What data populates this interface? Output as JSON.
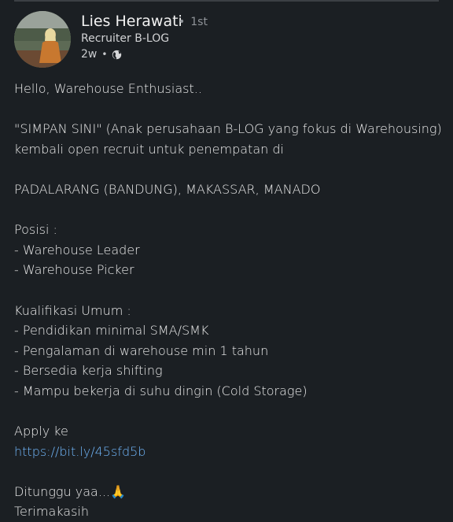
{
  "post": {
    "author": {
      "name": "Lies Herawati",
      "degree": "1st",
      "degree_separator": "•",
      "headline": "Recruiter B-LOG",
      "time": "2w",
      "visibility_icon": "globe-icon"
    },
    "body": {
      "greeting": "Hello, Warehouse Enthusiast..",
      "intro_line1": "\"SIMPAN SINI\" (Anak perusahaan B-LOG yang fokus di Warehousing)",
      "intro_line2": "kembali open recruit untuk penempatan di",
      "locations": "PADALARANG (BANDUNG), MAKASSAR, MANADO",
      "positions_heading": "Posisi :",
      "positions": [
        "- Warehouse Leader",
        "- Warehouse Picker"
      ],
      "qualifications_heading": "Kualifikasi Umum :",
      "qualifications": [
        "- Pendidikan minimal SMA/SMK",
        "- Pengalaman di warehouse min 1 tahun",
        "- Bersedia kerja shifting",
        "- Mampu bekerja di suhu dingin (Cold Storage)"
      ],
      "apply_label": "Apply ke",
      "apply_link": "https://bit.ly/45sfd5b",
      "closing_line1": "Ditunggu yaa...",
      "closing_emoji": "🙏",
      "closing_line2": "Terimakasih"
    }
  },
  "colors": {
    "background": "#1b1f23",
    "text": "#ececec",
    "muted": "#8f9398",
    "link": "#71b7fb"
  }
}
